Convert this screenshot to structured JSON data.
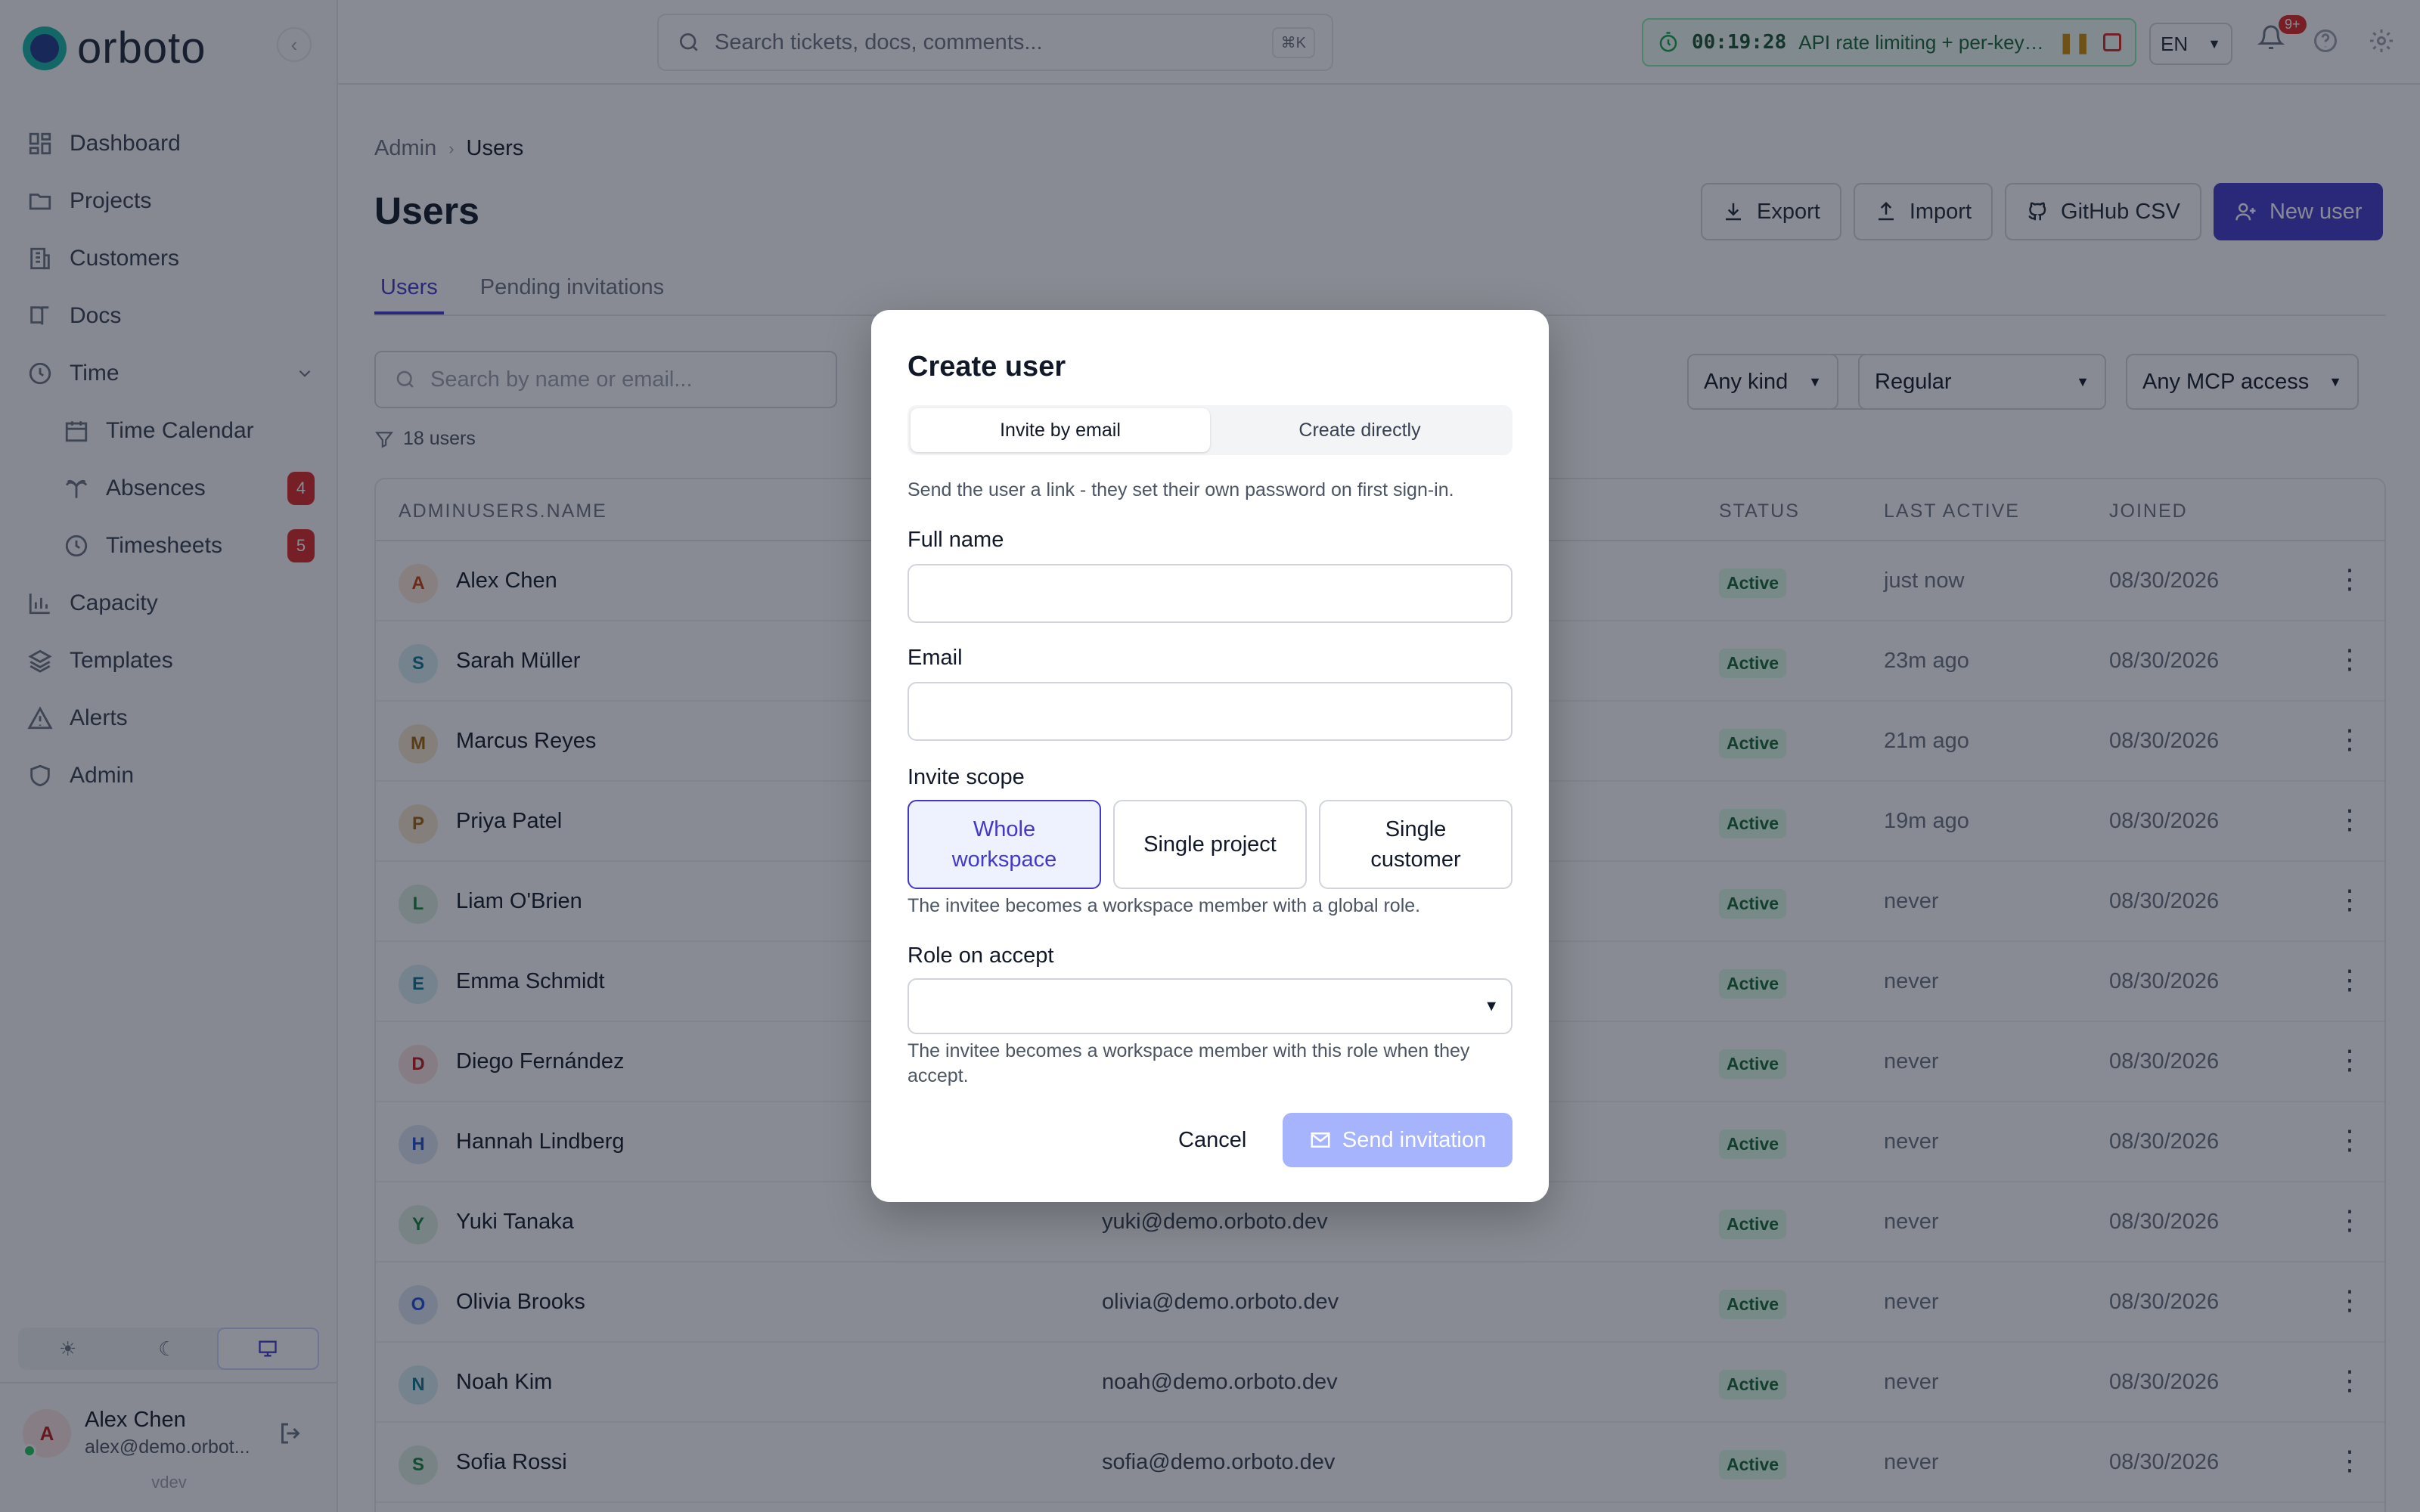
{
  "app": {
    "logo_text": "orboto",
    "env": "vdev"
  },
  "sidebar": {
    "items": [
      {
        "label": "Dashboard",
        "icon": "dashboard-icon"
      },
      {
        "label": "Projects",
        "icon": "folder-icon"
      },
      {
        "label": "Customers",
        "icon": "building-icon"
      },
      {
        "label": "Docs",
        "icon": "book-icon"
      },
      {
        "label": "Time",
        "icon": "clock-icon"
      },
      {
        "label": "Time Calendar",
        "icon": "calendar-icon"
      },
      {
        "label": "Absences",
        "icon": "palm-tree-icon",
        "badge": "4"
      },
      {
        "label": "Timesheets",
        "icon": "clock-icon",
        "badge": "5"
      },
      {
        "label": "Capacity",
        "icon": "bar-chart-icon"
      },
      {
        "label": "Templates",
        "icon": "layers-icon"
      },
      {
        "label": "Alerts",
        "icon": "alert-triangle-icon"
      },
      {
        "label": "Admin",
        "icon": "shield-icon"
      }
    ],
    "user": {
      "name": "Alex Chen",
      "email": "alex@demo.orbot...",
      "initial": "A"
    }
  },
  "topbar": {
    "search_placeholder": "Search tickets, docs, comments...",
    "search_shortcut": "⌘K",
    "timer_time": "00:19:28",
    "timer_task": "API rate limiting + per-key ...",
    "lang": "EN",
    "notif_count": "9+"
  },
  "page": {
    "breadcrumb": [
      "Admin",
      "Users"
    ],
    "title": "Users",
    "actions": {
      "export": "Export",
      "import": "Import",
      "github": "GitHub CSV",
      "new_user": "New user"
    },
    "tabs": [
      "Users",
      "Pending invitations"
    ],
    "search_placeholder": "Search by name or email...",
    "filters": {
      "status": "status",
      "kind": "Any kind",
      "regular": "Regular",
      "mcp": "Any MCP access"
    },
    "count": "18 users"
  },
  "table": {
    "headers": {
      "name": "ADMINUSERS.NAME",
      "status": "STATUS",
      "last_active": "LAST ACTIVE",
      "joined": "JOINED"
    },
    "rows": [
      {
        "initial": "A",
        "name": "Alex Chen",
        "email": "",
        "status": "Active",
        "last": "just now",
        "joined": "08/30/2026",
        "bg": "#fde7d9",
        "fg": "#c2410c"
      },
      {
        "initial": "S",
        "name": "Sarah Müller",
        "email": "",
        "status": "Active",
        "last": "23m ago",
        "joined": "08/30/2026",
        "bg": "#d7eef3",
        "fg": "#0e7490"
      },
      {
        "initial": "M",
        "name": "Marcus Reyes",
        "email": "",
        "status": "Active",
        "last": "21m ago",
        "joined": "08/30/2026",
        "bg": "#f6e6cf",
        "fg": "#a16207"
      },
      {
        "initial": "P",
        "name": "Priya Patel",
        "email": "",
        "status": "Active",
        "last": "19m ago",
        "joined": "08/30/2026",
        "bg": "#f6e6cf",
        "fg": "#a16207"
      },
      {
        "initial": "L",
        "name": "Liam O'Brien",
        "email": "",
        "status": "Active",
        "last": "never",
        "joined": "08/30/2026",
        "bg": "#dcefe1",
        "fg": "#15803d"
      },
      {
        "initial": "E",
        "name": "Emma Schmidt",
        "email": "",
        "status": "Active",
        "last": "never",
        "joined": "08/30/2026",
        "bg": "#d7eef3",
        "fg": "#0e7490"
      },
      {
        "initial": "D",
        "name": "Diego Fernández",
        "email": "",
        "status": "Active",
        "last": "never",
        "joined": "08/30/2026",
        "bg": "#fbe0e0",
        "fg": "#b91c1c"
      },
      {
        "initial": "H",
        "name": "Hannah Lindberg",
        "email": "",
        "status": "Active",
        "last": "never",
        "joined": "08/30/2026",
        "bg": "#dde6f5",
        "fg": "#1d4ed8"
      },
      {
        "initial": "Y",
        "name": "Yuki Tanaka",
        "email": "yuki@demo.orboto.dev",
        "status": "Active",
        "last": "never",
        "joined": "08/30/2026",
        "bg": "#dcefe1",
        "fg": "#15803d"
      },
      {
        "initial": "O",
        "name": "Olivia Brooks",
        "email": "olivia@demo.orboto.dev",
        "status": "Active",
        "last": "never",
        "joined": "08/30/2026",
        "bg": "#dde6f5",
        "fg": "#1d4ed8"
      },
      {
        "initial": "N",
        "name": "Noah Kim",
        "email": "noah@demo.orboto.dev",
        "status": "Active",
        "last": "never",
        "joined": "08/30/2026",
        "bg": "#d7eef3",
        "fg": "#0e7490"
      },
      {
        "initial": "S",
        "name": "Sofia Rossi",
        "email": "sofia@demo.orboto.dev",
        "status": "Active",
        "last": "never",
        "joined": "08/30/2026",
        "bg": "#dcefe1",
        "fg": "#15803d"
      }
    ]
  },
  "modal": {
    "title": "Create user",
    "seg": {
      "invite": "Invite by email",
      "direct": "Create directly"
    },
    "desc": "Send the user a link - they set their own password on first sign-in.",
    "full_name_label": "Full name",
    "email_label": "Email",
    "scope_label": "Invite scope",
    "scope_options": [
      "Whole workspace",
      "Single project",
      "Single customer"
    ],
    "scope_hint": "The invitee becomes a workspace member with a global role.",
    "role_label": "Role on accept",
    "role_hint": "The invitee becomes a workspace member with this role when they accept.",
    "cancel": "Cancel",
    "send": "Send invitation"
  }
}
